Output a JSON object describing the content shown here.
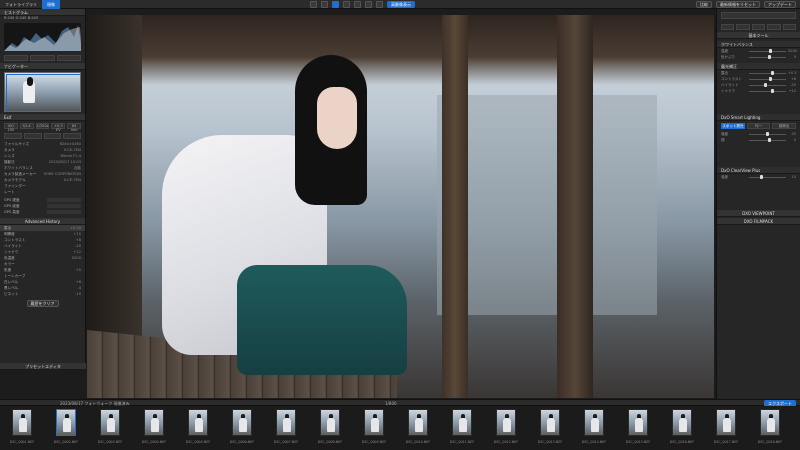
{
  "topbar": {
    "tabs": [
      "フォトライブラリ",
      "現像"
    ],
    "center_labels": [
      "高解像表示"
    ],
    "right_labels": [
      "比較",
      "最新情報をリセット",
      "アップデート"
    ]
  },
  "left": {
    "histogram_title": "ヒストグラム",
    "histogram_info": "R:245 G:245 B:245",
    "navigator_title": "ナビゲーター",
    "exif_title": "Exif",
    "exif_buttons": [
      "ISO 100",
      "f/1.4",
      "1/320s",
      "+0.3 EV",
      "85 mm"
    ],
    "exif_rows": [
      {
        "label": "ファイルサイズ",
        "value": "6240×4160"
      },
      {
        "label": "カメラ",
        "value": "ILCE-7M4"
      },
      {
        "label": "レンズ",
        "value": "85mm F1.4"
      },
      {
        "label": "撮影日",
        "value": "2023/08/17 15:03"
      },
      {
        "label": "ホワイトバランス",
        "value": "自動"
      },
      {
        "label": "カメラ製造メーカー",
        "value": "SONY CORPORATION"
      },
      {
        "label": "カメラモデル",
        "value": "ILCE-7M4"
      },
      {
        "label": "ファインダー",
        "value": ""
      },
      {
        "label": "レート",
        "value": ""
      }
    ],
    "gps_rows": [
      "GPS 緯度",
      "GPS 経度",
      "GPS 高度"
    ],
    "history_title": "Advanced History",
    "history_rows": [
      {
        "label": "露出",
        "value": "+0.30"
      },
      {
        "label": "明瞭度",
        "value": "+15"
      },
      {
        "label": "コントラスト",
        "value": "+8"
      },
      {
        "label": "ハイライト",
        "value": "-20"
      },
      {
        "label": "シャドウ",
        "value": "+12"
      },
      {
        "label": "色温度",
        "value": "5200"
      },
      {
        "label": "カラー",
        "value": ""
      },
      {
        "label": "彩度",
        "value": "+5"
      },
      {
        "label": "トーンカーブ",
        "value": ""
      },
      {
        "label": "白レベル",
        "value": "+6"
      },
      {
        "label": "黒レベル",
        "value": "-4"
      },
      {
        "label": "ビネット",
        "value": "-10"
      }
    ],
    "history_button": "履歴をクリア",
    "footer": "プリセットエディタ"
  },
  "right": {
    "panel_title": "基本ツール",
    "sections": [
      {
        "title": "ホワイトバランス",
        "sliders": [
          {
            "label": "温度",
            "pos": 0.55,
            "val": "5200"
          },
          {
            "label": "色かぶり",
            "pos": 0.5,
            "val": "0"
          }
        ]
      },
      {
        "title": "露光補正",
        "sliders": [
          {
            "label": "露出",
            "pos": 0.6,
            "val": "+0.3"
          },
          {
            "label": "コントラスト",
            "pos": 0.55,
            "val": "+8"
          },
          {
            "label": "ハイライト",
            "pos": 0.4,
            "val": "-20"
          },
          {
            "label": "シャドウ",
            "pos": 0.6,
            "val": "+12"
          }
        ]
      },
      {
        "title": "DxO Smart Lighting",
        "sliders": [
          {
            "label": "強度",
            "pos": 0.45,
            "val": "25"
          },
          {
            "label": "顔",
            "pos": 0.5,
            "val": "0"
          }
        ]
      },
      {
        "title": "DxO ClearView Plus",
        "sliders": [
          {
            "label": "強度",
            "pos": 0.3,
            "val": "10"
          }
        ]
      }
    ],
    "options": [
      "スポット測光",
      "均一",
      "顔検出"
    ],
    "footers": [
      "DXO VIEWPOINT",
      "DXO FILMPACK"
    ]
  },
  "film": {
    "bar_left": "2023/08/17 フォトウォーク 現像済み",
    "bar_count": "1/800",
    "bar_right": "エクスポート",
    "items": [
      "DSC_0001.NEF",
      "DSC_0002.NEF",
      "DSC_0003.NEF",
      "DSC_0004.NEF",
      "DSC_0005.NEF",
      "DSC_0006.NEF",
      "DSC_0007.NEF",
      "DSC_0008.NEF",
      "DSC_0009.NEF",
      "DSC_0010.NEF",
      "DSC_0011.NEF",
      "DSC_0012.NEF",
      "DSC_0013.NEF",
      "DSC_0014.NEF",
      "DSC_0015.NEF",
      "DSC_0016.NEF",
      "DSC_0017.NEF",
      "DSC_0018.NEF"
    ]
  }
}
